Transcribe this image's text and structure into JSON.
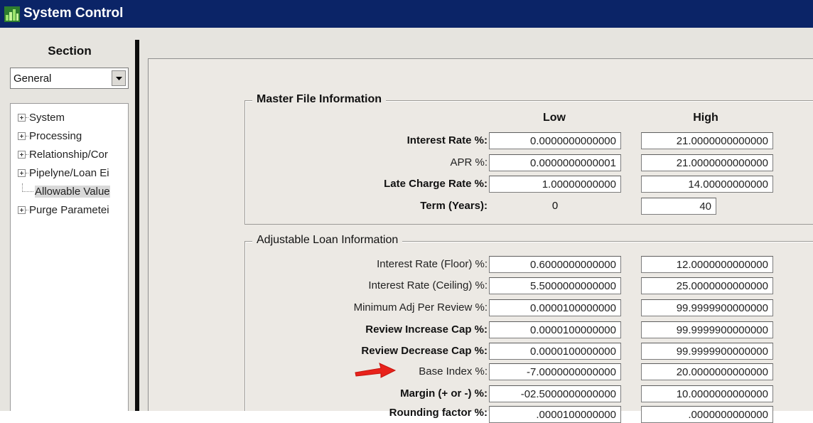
{
  "window": {
    "title": "System Control"
  },
  "sidebar": {
    "section_label": "Section",
    "section_select": {
      "value": "General"
    },
    "tree": [
      {
        "label": "System",
        "expandable": true,
        "selected": false
      },
      {
        "label": "Processing",
        "expandable": true,
        "selected": false
      },
      {
        "label": "Relationship/Cor",
        "expandable": true,
        "selected": false
      },
      {
        "label": "Pipelyne/Loan Ei",
        "expandable": true,
        "selected": false
      },
      {
        "label": "Allowable Value",
        "expandable": false,
        "selected": true
      },
      {
        "label": "Purge Parametei",
        "expandable": true,
        "selected": false
      }
    ]
  },
  "master_file": {
    "title": "Master File Information",
    "col_low": "Low",
    "col_high": "High",
    "rows": [
      {
        "label": "Interest Rate %:",
        "low": "0.0000000000000",
        "high": "21.0000000000000"
      },
      {
        "label": "APR %:",
        "low": "0.0000000000001",
        "high": "21.0000000000000"
      },
      {
        "label": "Late Charge Rate %:",
        "low": "1.00000000000",
        "high": "14.00000000000"
      },
      {
        "label": "Term (Years):",
        "low": "0",
        "high": "40"
      }
    ]
  },
  "adjustable_loan": {
    "title": "Adjustable Loan Information",
    "rows": [
      {
        "label": "Interest Rate (Floor) %:",
        "low": "0.6000000000000",
        "high": "12.0000000000000"
      },
      {
        "label": "Interest Rate (Ceiling) %:",
        "low": "5.5000000000000",
        "high": "25.0000000000000"
      },
      {
        "label": "Minimum Adj Per Review %:",
        "low": "0.0000100000000",
        "high": "99.9999900000000"
      },
      {
        "label": "Review Increase Cap %:",
        "low": "0.0000100000000",
        "high": "99.9999900000000"
      },
      {
        "label": "Review Decrease Cap %:",
        "low": "0.0000100000000",
        "high": "99.9999900000000"
      },
      {
        "label": "Base Index %:",
        "low": "-7.0000000000000",
        "high": "20.0000000000000"
      },
      {
        "label": "Margin (+ or -) %:",
        "low": "-02.5000000000000",
        "high": "10.0000000000000"
      },
      {
        "label": "Rounding factor %:",
        "low": ".0000100000000",
        "high": ".0000000000000"
      }
    ]
  },
  "annotation": {
    "arrow_color": "#e8221b"
  }
}
